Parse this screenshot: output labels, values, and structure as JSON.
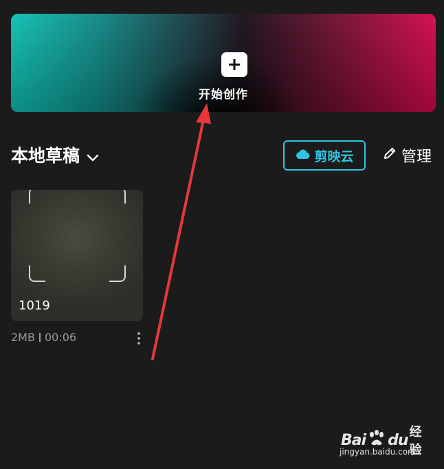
{
  "create": {
    "label": "开始创作"
  },
  "drafts_section": {
    "title": "本地草稿",
    "cloud_label": "剪映云",
    "manage_label": "管理"
  },
  "drafts": [
    {
      "name": "1019",
      "size": "2MB",
      "duration": "00:06"
    }
  ],
  "watermark": {
    "brand_a": "Bai",
    "brand_b": "du",
    "brand_c": "经验",
    "url": "jingyan.baidu.com"
  },
  "colors": {
    "background": "#1b1b1b",
    "accent_cyan": "#2ec5e3",
    "annotation_red": "#e8383a"
  }
}
